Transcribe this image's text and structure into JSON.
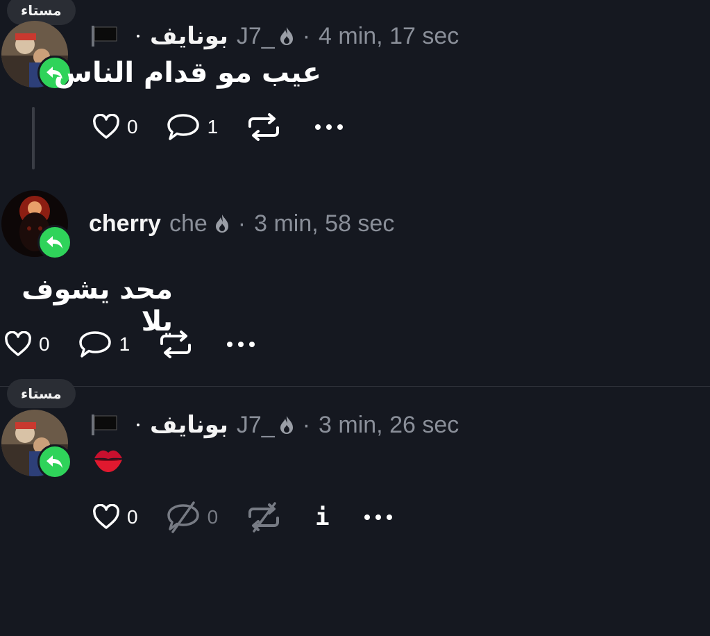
{
  "posts": [
    {
      "chip": "مستاء",
      "name": "بونايف",
      "handle": "J7_",
      "time": "4 min, 17 sec",
      "text": "عيب مو قدام الناس",
      "likes": "0",
      "replies": "1",
      "icons": [
        "flag-icon",
        "crescent-icon",
        "flame-icon"
      ]
    },
    {
      "name": "cherry",
      "handle": "che",
      "time": "3 min, 58 sec",
      "text": "محد يشوف يلا",
      "likes": "0",
      "replies": "1"
    },
    {
      "chip": "مستاء",
      "name": "بونايف",
      "handle": "J7_",
      "time": "3 min, 26 sec",
      "text": "💋",
      "likes": "0",
      "replies": "0",
      "info": "i"
    }
  ],
  "sep": "·",
  "colors": {
    "background": "#151820",
    "accent": "#2fd35a",
    "muted": "#8a8f99"
  }
}
